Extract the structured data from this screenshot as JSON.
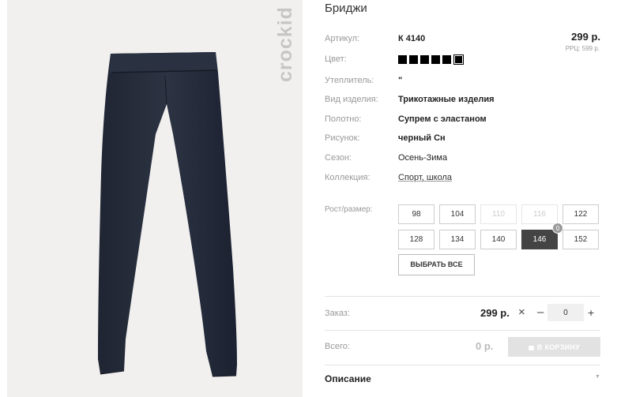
{
  "product": {
    "title": "Бриджи",
    "watermark": "crockid",
    "image_alt": "leggings"
  },
  "price": {
    "main": "299 р.",
    "rrp": "РРЦ: 599 р."
  },
  "attributes": [
    {
      "label": "Артикул:",
      "value": "К 4140"
    },
    {
      "label": "Цвет:",
      "value": ""
    },
    {
      "label": "Утеплитель:",
      "value": "\""
    },
    {
      "label": "Вид изделия:",
      "value": "Трикотажные изделия"
    },
    {
      "label": "Полотно:",
      "value": "Супрем с эластаном"
    },
    {
      "label": "Рисунок:",
      "value": "черный Сн"
    },
    {
      "label": "Сезон:",
      "value": "Осень-Зима"
    },
    {
      "label": "Коллекция:",
      "value": "Спорт, школа"
    }
  ],
  "colors": {
    "swatch_count": 6,
    "selected_index": 5,
    "swatch_color": "#000000"
  },
  "sizes": {
    "label": "Рост/размер:",
    "items": [
      {
        "label": "98",
        "state": "normal"
      },
      {
        "label": "104",
        "state": "normal"
      },
      {
        "label": "110",
        "state": "disabled"
      },
      {
        "label": "116",
        "state": "disabled"
      },
      {
        "label": "122",
        "state": "normal"
      },
      {
        "label": "128",
        "state": "normal"
      },
      {
        "label": "134",
        "state": "normal"
      },
      {
        "label": "140",
        "state": "normal"
      },
      {
        "label": "146",
        "state": "active"
      },
      {
        "label": "152",
        "state": "normal"
      }
    ],
    "badge": "0",
    "select_all": "ВЫБРАТЬ ВСЕ"
  },
  "order": {
    "label": "Заказ:",
    "price": "299 р.",
    "clear": "×",
    "minus": "–",
    "quantity": "0",
    "plus": "+"
  },
  "total": {
    "label": "Всего:",
    "value": "0 р.",
    "cart_button": "В КОРЗИНУ"
  },
  "description": {
    "title": "Описание",
    "arrow": "▼"
  },
  "palette": {
    "accent_active": "#444444",
    "cart_disabled": "#e2e2e2",
    "image_bg": "#f1f0ef"
  }
}
